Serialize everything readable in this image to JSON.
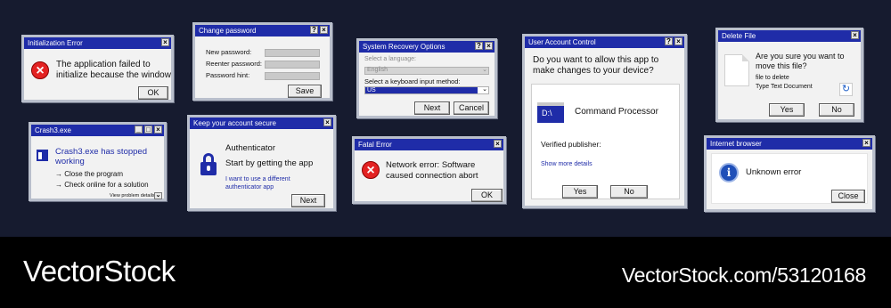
{
  "init_error": {
    "title": "Initialization Error",
    "message_line1": "The application failed to",
    "message_line2": "initialize because the window",
    "ok": "OK",
    "icon": "error-icon"
  },
  "change_password": {
    "title": "Change password",
    "new_password_label": "New password:",
    "reenter_label": "Reenter password:",
    "hint_label": "Password hint:",
    "save": "Save"
  },
  "recovery": {
    "title": "System Recovery Options",
    "language_label": "Select a language:",
    "language_value": "English",
    "keyboard_label": "Select a keyboard input method:",
    "keyboard_value": "US",
    "next": "Next",
    "cancel": "Cancel"
  },
  "uac": {
    "title": "User Account Control",
    "question_line1": "Do you want to allow this app to",
    "question_line2": "make changes to your device?",
    "drive_label": "D:\\",
    "app_name": "Command Processor",
    "publisher": "Verified publisher:",
    "details_link": "Show more details",
    "yes": "Yes",
    "no": "No"
  },
  "delete_file": {
    "title": "Delete File",
    "question_line1": "Are you sure you want to",
    "question_line2": "move this file?",
    "file_line1": "file to delete",
    "file_line2": "Type Text Document",
    "yes": "Yes",
    "no": "No"
  },
  "crash": {
    "title": "Crash3.exe",
    "message_line1": "Crash3.exe has stopped",
    "message_line2": "working",
    "option1": "Close the program",
    "option2": "Check online for a solution",
    "details": "View problem details"
  },
  "secure": {
    "title": "Keep your account secure",
    "app": "Authenticator",
    "heading": "Start by getting the app",
    "link_line1": "I want to use a different",
    "link_line2": "authenticator app",
    "next": "Next"
  },
  "fatal": {
    "title": "Fatal Error",
    "message_line1": "Network error: Software",
    "message_line2": "caused connection abort",
    "ok": "OK"
  },
  "browser": {
    "title": "Internet browser",
    "message": "Unknown error",
    "close": "Close"
  },
  "watermark": {
    "brand": "VectorStock",
    "url": "VectorStock.com/53120168"
  },
  "colors": {
    "titlebar": "#1f2ca8",
    "error": "#e32222",
    "background": "#161b2f"
  }
}
